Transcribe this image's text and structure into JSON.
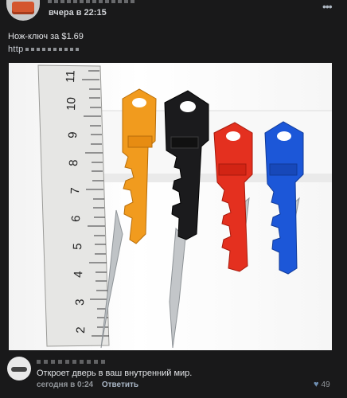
{
  "post": {
    "time": "вчера в 22:15",
    "text": "Нож-ключ за $1.69",
    "link_prefix": "http",
    "more_icon": "more-dots-icon"
  },
  "photo": {
    "ruler_numbers": [
      "2",
      "3",
      "4",
      "5",
      "6",
      "7",
      "8",
      "9",
      "10",
      "11"
    ],
    "knives": [
      {
        "color": "#f19b1e"
      },
      {
        "color": "#1b1b1d"
      },
      {
        "color": "#e4301f"
      },
      {
        "color": "#1c57d8"
      }
    ]
  },
  "comment": {
    "text": "Откроет дверь в ваш внутренний мир.",
    "time": "сегодня в 0:24",
    "reply_label": "Ответить",
    "likes": "49",
    "like_icon": "heart-icon"
  }
}
